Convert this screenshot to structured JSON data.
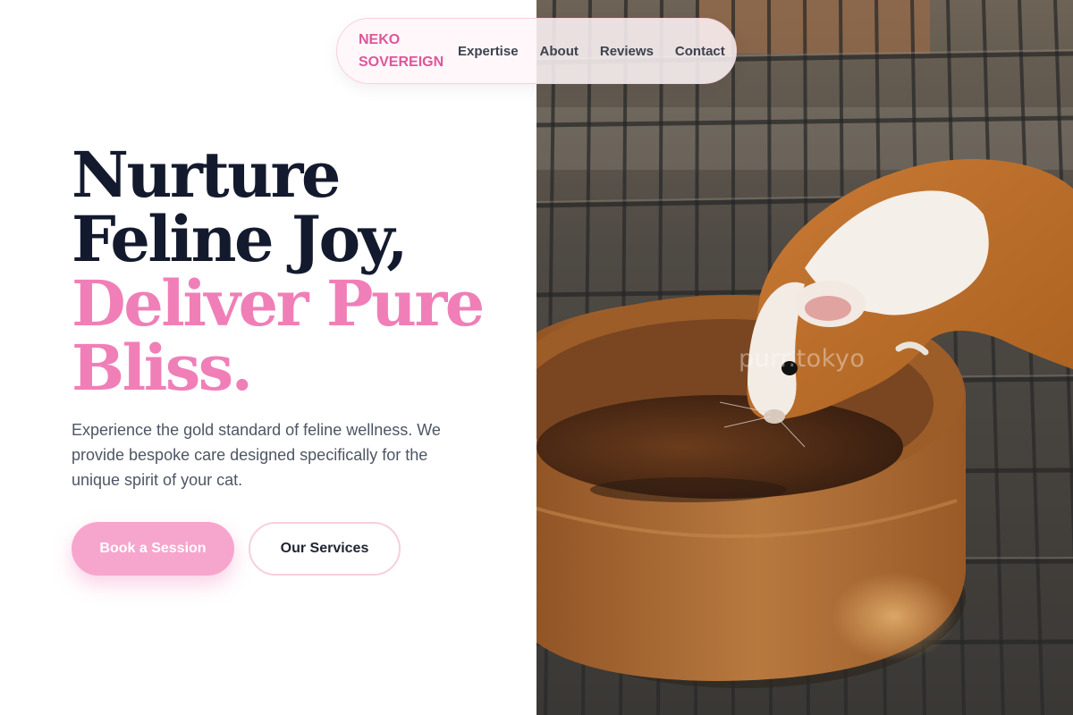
{
  "brand": {
    "line1": "NEKO",
    "line2": "SOVEREIGN",
    "color": "#e0559a"
  },
  "nav": {
    "items": [
      "Expertise",
      "About",
      "Reviews",
      "Contact"
    ]
  },
  "hero": {
    "title_dark": [
      "Nurture",
      "Feline Joy,"
    ],
    "title_pink": [
      "Deliver Pure",
      "Bliss."
    ],
    "subtitle": "Experience the gold standard of feline wellness. We provide bespoke care designed specifically for the unique spirit of your cat.",
    "primary_button": "Book a Session",
    "secondary_button": "Our Services"
  },
  "image": {
    "subject": "guinea pig drinking from a clay water bowl on a wire grid",
    "watermark": "purr.tokyo"
  },
  "colors": {
    "title_dark": "#141a2e",
    "title_pink": "#f07fb8",
    "button_primary": "#f6a6cd",
    "nav_border": "#f7cfdd"
  }
}
